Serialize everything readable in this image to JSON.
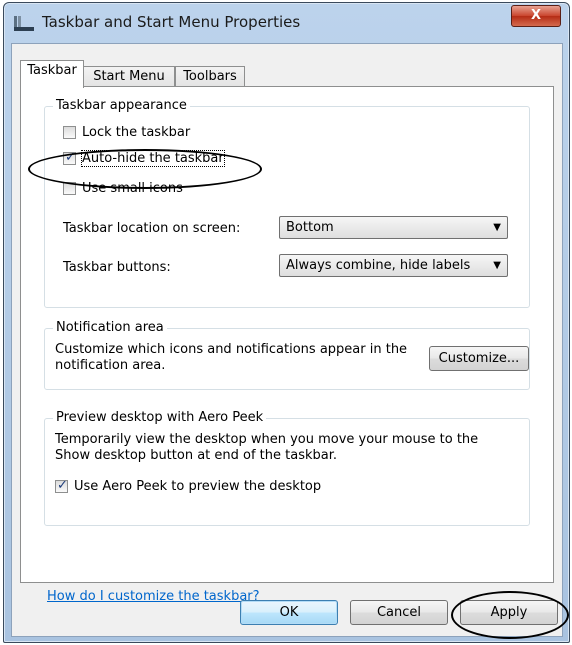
{
  "window": {
    "title": "Taskbar and Start Menu Properties",
    "close_glyph": "X"
  },
  "tabs": [
    {
      "label": "Taskbar",
      "active": true
    },
    {
      "label": "Start Menu",
      "active": false
    },
    {
      "label": "Toolbars",
      "active": false
    }
  ],
  "appearance": {
    "title": "Taskbar appearance",
    "lock": {
      "label": "Lock the taskbar",
      "checked": false
    },
    "autohide": {
      "label": "Auto-hide the taskbar",
      "checked": true
    },
    "small_icons": {
      "label": "Use small icons",
      "checked": false
    },
    "location_label": "Taskbar location on screen:",
    "location_value": "Bottom",
    "buttons_label": "Taskbar buttons:",
    "buttons_value": "Always combine, hide labels"
  },
  "notification": {
    "title": "Notification area",
    "desc": "Customize which icons and notifications appear in the notification area.",
    "customize_label": "Customize..."
  },
  "peek": {
    "title": "Preview desktop with Aero Peek",
    "desc": "Temporarily view the desktop when you move your mouse to the Show desktop button at end of the taskbar.",
    "use_label": "Use Aero Peek to preview the desktop",
    "checked": true
  },
  "help_link": "How do I customize the taskbar?",
  "footer": {
    "ok": "OK",
    "cancel": "Cancel",
    "apply": "Apply"
  },
  "colors": {
    "link": "#0066cc",
    "close": "#c9442c",
    "titlebar": "#bcd3ec"
  }
}
